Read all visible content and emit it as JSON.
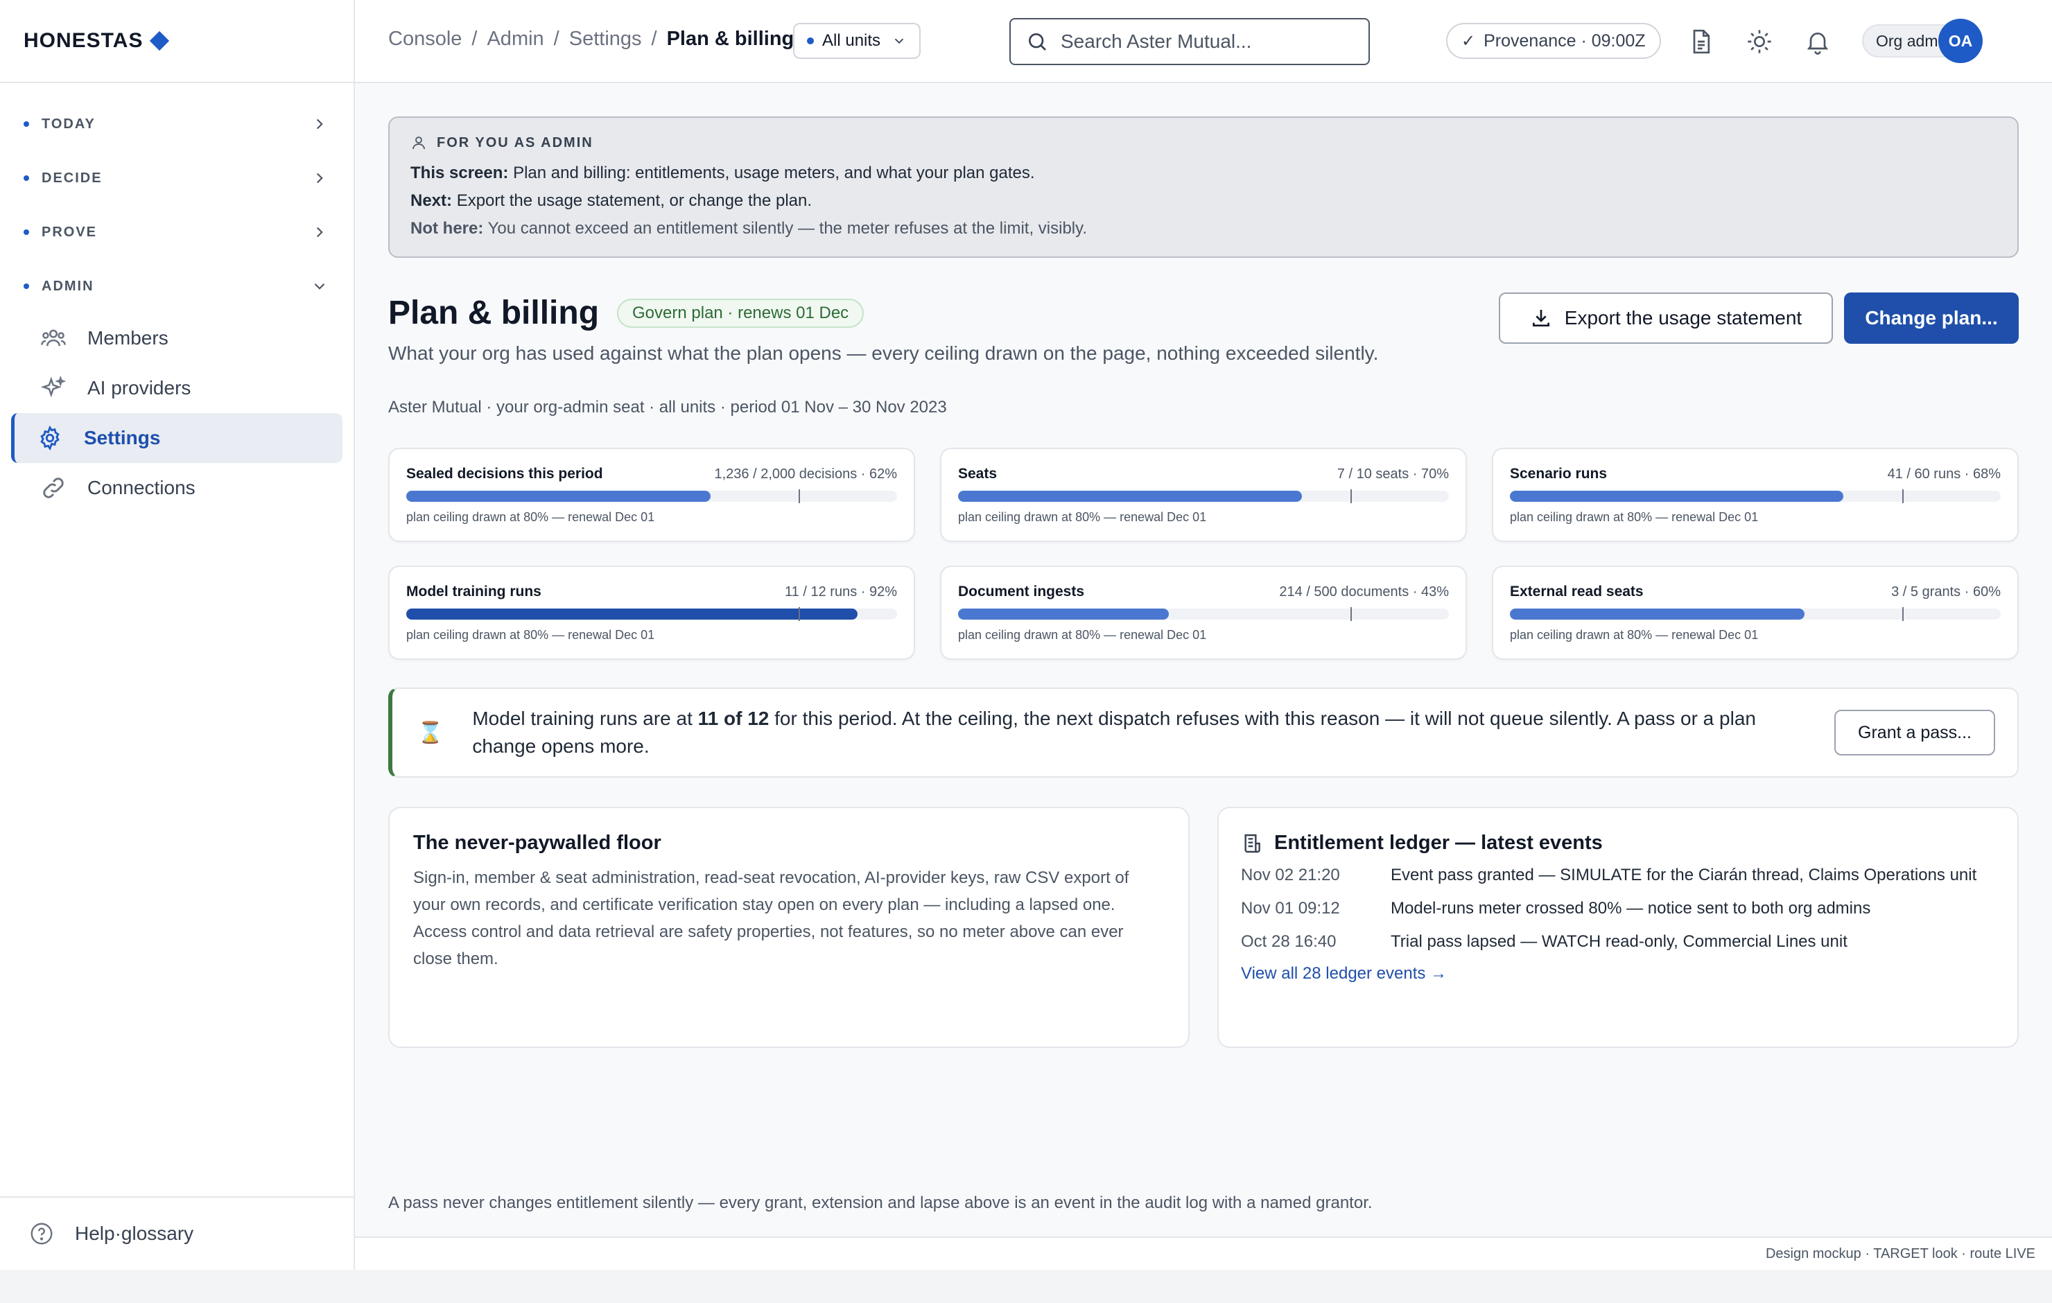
{
  "brand": {
    "name": "HONESTAS"
  },
  "sidebar": {
    "sections": [
      {
        "label": "TODAY"
      },
      {
        "label": "DECIDE"
      },
      {
        "label": "PROVE"
      },
      {
        "label": "ADMIN"
      }
    ],
    "admin_items": [
      {
        "label": "Members",
        "icon": "members-icon"
      },
      {
        "label": "AI providers",
        "icon": "sparkle-icon"
      },
      {
        "label": "Settings",
        "icon": "gear-icon",
        "active": true
      },
      {
        "label": "Connections",
        "icon": "link-icon"
      }
    ],
    "help": {
      "label": "Help·glossary"
    }
  },
  "topbar": {
    "breadcrumb": [
      "Console",
      "Admin",
      "Settings",
      "Plan & billing"
    ],
    "units": "All units",
    "search_placeholder": "Search Aster Mutual...",
    "provenance": "Provenance · 09:00Z",
    "role": "Org admin",
    "avatar": "OA"
  },
  "callout": {
    "kicker": "FOR YOU AS ADMIN",
    "this_label": "This screen:",
    "this_text": "Plan and billing: entitlements, usage meters, and what your plan gates.",
    "next_label": "Next:",
    "next_text": "Export the usage statement, or change the plan.",
    "not_label": "Not here:",
    "not_text": "You cannot exceed an entitlement silently — the meter refuses at the limit, visibly."
  },
  "page": {
    "title": "Plan & billing",
    "plan_badge": "Govern plan · renews 01 Dec",
    "subtitle": "What your org has used against what the plan opens — every ceiling drawn on the page, nothing exceeded silently.",
    "export_label": "Export the usage statement",
    "change_label": "Change plan...",
    "context": "Aster Mutual · your org-admin seat · all units · period 01 Nov – 30 Nov 2023"
  },
  "meters": [
    {
      "name": "Sealed decisions this period",
      "value": "1,236 / 2,000 decisions · 62%",
      "pct": 62,
      "ceiling": 80,
      "note": "plan ceiling drawn at 80% — renewal Dec 01"
    },
    {
      "name": "Seats",
      "value": "7 / 10 seats · 70%",
      "pct": 70,
      "ceiling": 80,
      "note": "plan ceiling drawn at 80% — renewal Dec 01"
    },
    {
      "name": "Scenario runs",
      "value": "41 / 60 runs · 68%",
      "pct": 68,
      "ceiling": 80,
      "note": "plan ceiling drawn at 80% — renewal Dec 01"
    },
    {
      "name": "Model training runs",
      "value": "11 / 12 runs · 92%",
      "pct": 92,
      "ceiling": 80,
      "note": "plan ceiling drawn at 80% — renewal Dec 01"
    },
    {
      "name": "Document ingests",
      "value": "214 / 500 documents · 43%",
      "pct": 43,
      "ceiling": 80,
      "note": "plan ceiling drawn at 80% — renewal Dec 01"
    },
    {
      "name": "External read seats",
      "value": "3 / 5 grants · 60%",
      "pct": 60,
      "ceiling": 80,
      "note": "plan ceiling drawn at 80% — renewal Dec 01"
    }
  ],
  "warning": {
    "pre": "Model training runs are at ",
    "strong": "11 of 12",
    "post": " for this period. At the ceiling, the next dispatch refuses with this reason — it will not queue silently. A pass or a plan change opens more.",
    "button": "Grant a pass..."
  },
  "floor": {
    "title": "The never-paywalled floor",
    "body": "Sign-in, member & seat administration, read-seat revocation, AI-provider keys, raw CSV export of your own records, and certificate verification stay open on every plan — including a lapsed one. Access control and data retrieval are safety properties, not features, so no meter above can ever close them."
  },
  "ledger": {
    "title": "Entitlement ledger — latest events",
    "events": [
      {
        "when": "Nov 02 21:20",
        "what": "Event pass granted — SIMULATE for the Ciarán thread, Claims Operations unit"
      },
      {
        "when": "Nov 01 09:12",
        "what": "Model-runs meter crossed 80% — notice sent to both org admins"
      },
      {
        "when": "Oct 28 16:40",
        "what": "Trial pass lapsed — WATCH read-only, Commercial Lines unit"
      }
    ],
    "view_all": "View all 28 ledger events →"
  },
  "footnote": "A pass never changes entitlement silently — every grant, extension and lapse above is an event in the audit log with a named grantor.",
  "statusbar": "Design mockup · TARGET look · route LIVE",
  "colors": {
    "accent": "#1f5bc6",
    "primary_button": "#1f4faa",
    "meter_fill": "#4a78d1",
    "warning_border": "#3e7a3f",
    "plan_badge": "#2e6b35"
  }
}
